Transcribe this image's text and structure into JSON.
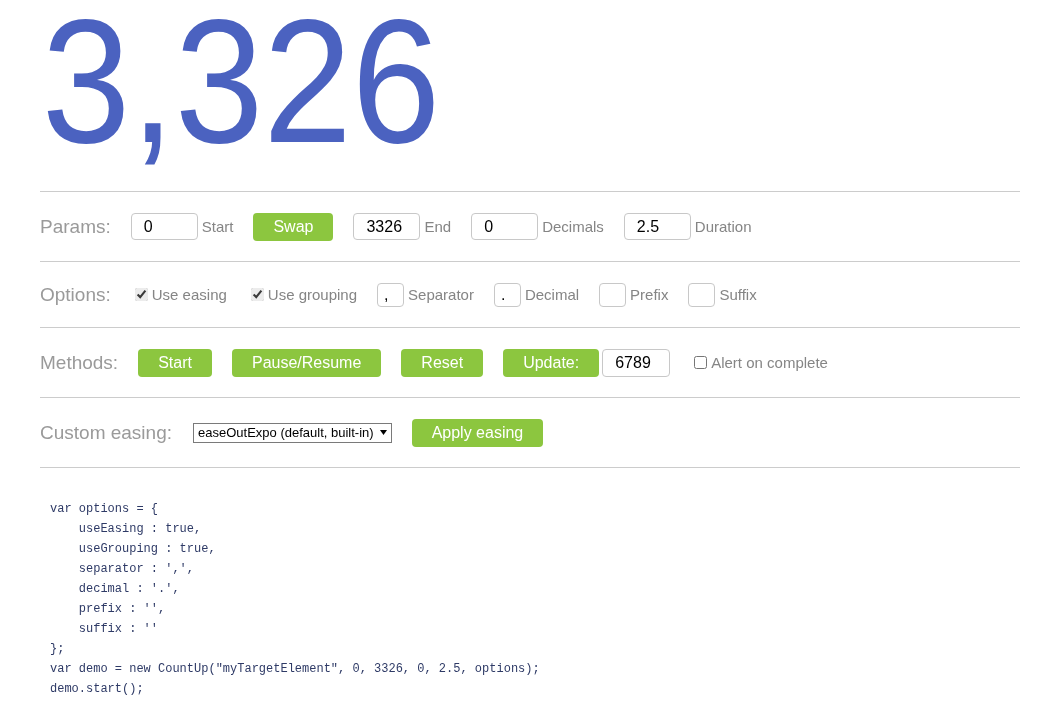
{
  "counter": {
    "value": "3,326"
  },
  "sections": [
    {
      "label": "Params:",
      "controls": [
        {
          "kind": "field",
          "value": "0",
          "caption": "Start"
        },
        {
          "kind": "button",
          "label": "Swap"
        },
        {
          "kind": "field",
          "value": "3326",
          "caption": "End"
        },
        {
          "kind": "field",
          "value": "0",
          "caption": "Decimals"
        },
        {
          "kind": "field",
          "value": "2.5",
          "caption": "Duration"
        }
      ]
    },
    {
      "label": "Options:",
      "controls": [
        {
          "kind": "checkbox",
          "checked": true,
          "caption": "Use easing"
        },
        {
          "kind": "checkbox",
          "checked": true,
          "caption": "Use grouping"
        },
        {
          "kind": "char",
          "value": ",",
          "caption": "Separator"
        },
        {
          "kind": "char",
          "value": ".",
          "caption": "Decimal"
        },
        {
          "kind": "char",
          "caption": "Prefix"
        },
        {
          "kind": "char",
          "caption": "Suffix"
        }
      ]
    },
    {
      "label": "Methods:",
      "controls": [
        {
          "kind": "button",
          "label": "Start"
        },
        {
          "kind": "button",
          "label": "Pause/Resume"
        },
        {
          "kind": "button",
          "label": "Reset"
        },
        {
          "kind": "combo",
          "label": "Update:",
          "value": "6789"
        },
        {
          "kind": "checkbox",
          "checked": false,
          "caption": "Alert on complete"
        }
      ]
    },
    {
      "label": "Custom easing:",
      "controls": [
        {
          "kind": "select",
          "value": "easeOutExpo (default, built-in)"
        },
        {
          "kind": "button",
          "label": "Apply easing"
        }
      ]
    }
  ],
  "code": {
    "lines": [
      "var options = {",
      "    useEasing : true,",
      "    useGrouping : true,",
      "    separator : ',',",
      "    decimal : '.',",
      "    prefix : '',",
      "    suffix : ''",
      "};",
      "var demo = new CountUp(\"myTargetElement\", 0, 3326, 0, 2.5, options);",
      "demo.start();"
    ]
  }
}
